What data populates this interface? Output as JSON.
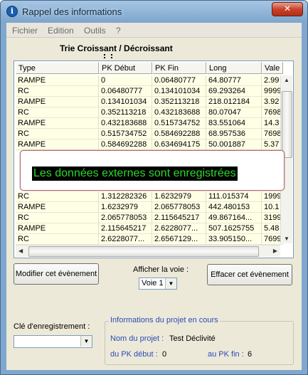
{
  "window": {
    "title": "Rappel des informations",
    "close_glyph": "✕",
    "info_icon": "i"
  },
  "menu": [
    "Fichier",
    "Edition",
    "Outils",
    "?"
  ],
  "sort_label": "Trie Croissant / Décroissant",
  "table": {
    "columns": [
      "Type",
      "PK Début",
      "PK Fin",
      "Long",
      "Vale"
    ],
    "rows_top": [
      [
        "RAMPE",
        "0",
        "0.06480777",
        "64.80777",
        "2.99"
      ],
      [
        "RC",
        "0.06480777",
        "0.134101034",
        "69.293264",
        "9999"
      ],
      [
        "RAMPE",
        "0.134101034",
        "0.352113218",
        "218.012184",
        "3.92"
      ],
      [
        "RC",
        "0.352113218",
        "0.432183688",
        "80.07047",
        "7698"
      ],
      [
        "RAMPE",
        "0.432183688",
        "0.515734752",
        "83.551064",
        "14.3"
      ],
      [
        "RC",
        "0.515734752",
        "0.584692288",
        "68.957536",
        "7698"
      ],
      [
        "RAMPE",
        "0.584692288",
        "0.634694175",
        "50.001887",
        "5.37"
      ]
    ],
    "rows_bottom": [
      [
        "RC",
        "1.3122823​26",
        "1.6232979",
        "111.015374",
        "1999"
      ],
      [
        "RAMPE",
        "1.6232979",
        "2.065778053",
        "442.480153",
        "10.1"
      ],
      [
        "RC",
        "2.065778053",
        "2.115645217",
        "49.867164...",
        "3199"
      ],
      [
        "RAMPE",
        "2.115645217",
        "2.6228077...",
        "507.1625755",
        "5.48"
      ],
      [
        "RC",
        "2.6228077...",
        "2.6567129...",
        "33.905150...",
        "7699"
      ]
    ]
  },
  "message": "Les données externes sont enregistrées",
  "buttons": {
    "modify": "Modifier cet évènement",
    "erase": "Effacer cet évènement"
  },
  "show_lane": {
    "label": "Afficher la voie :",
    "value": "Voie 1"
  },
  "record_key": {
    "label": "Clé d'enregistrement :",
    "value": ""
  },
  "project_info": {
    "title": "Informations du projet en cours",
    "name_label": "Nom du projet :",
    "name_value": "Test Déclivité",
    "pk_start_label": "du PK début :",
    "pk_start_value": "0",
    "pk_end_label": "au PK fin :",
    "pk_end_value": "6"
  },
  "colors": {
    "row_bg": "#ffffe6",
    "message_text": "#2adb2a",
    "group_title": "#2a4cb8"
  }
}
